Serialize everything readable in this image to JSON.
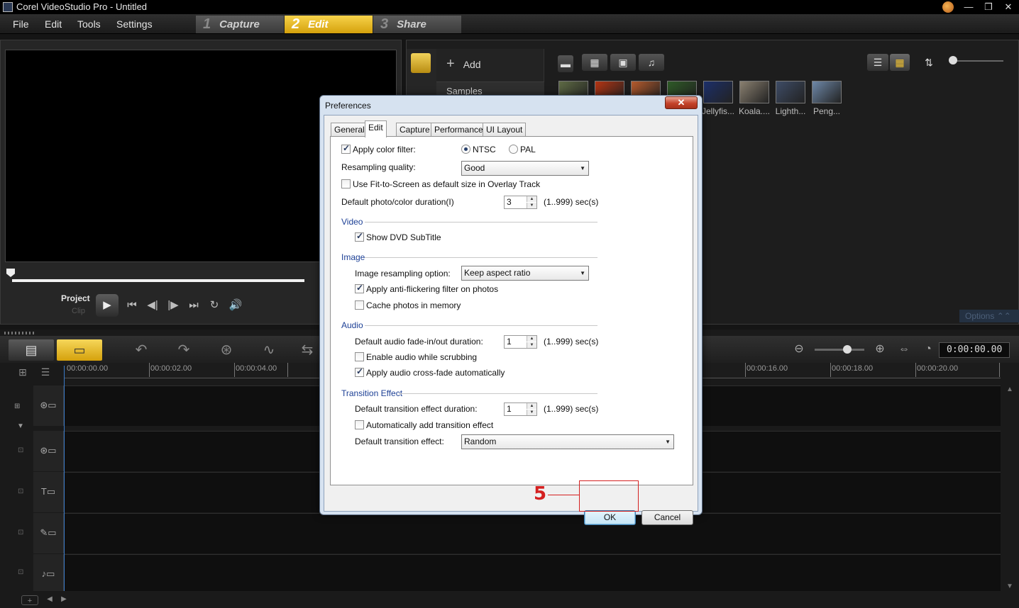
{
  "window": {
    "title": "Corel VideoStudio Pro - Untitled"
  },
  "menu": [
    "File",
    "Edit",
    "Tools",
    "Settings"
  ],
  "steps": [
    {
      "num": "1",
      "label": "Capture",
      "active": false
    },
    {
      "num": "2",
      "label": "Edit",
      "active": true
    },
    {
      "num": "3",
      "label": "Share",
      "active": false
    }
  ],
  "player": {
    "project_label": "Project",
    "clip_label": "Clip"
  },
  "library": {
    "add_label": "Add",
    "samples_label": "Samples",
    "thumbnails": [
      {
        "label": "",
        "color": "#5e6a44"
      },
      {
        "label": "",
        "color": "#b53412"
      },
      {
        "label": "",
        "color": "#b55a2c"
      },
      {
        "label": "",
        "color": "#2e5a26"
      },
      {
        "label": "Jellyfis...",
        "color": "#1c2f6a"
      },
      {
        "label": "Koala....",
        "color": "#8a8070"
      },
      {
        "label": "Lighth...",
        "color": "#3e4c66"
      },
      {
        "label": "Peng...",
        "color": "#6e88a8"
      }
    ],
    "options_label": "Options"
  },
  "timeline": {
    "timecode": "0:00:00.00",
    "ticks": [
      "00:00:00.00",
      "00:00:02.00",
      "00:00:04.00",
      "00:00:16.00",
      "00:00:18.00",
      "00:00:20.00"
    ]
  },
  "dialog": {
    "title": "Preferences",
    "close_label": "✕",
    "tabs": [
      "General",
      "Edit",
      "Capture",
      "Performance",
      "UI Layout"
    ],
    "active_tab": "Edit",
    "apply_color_filter": {
      "label": "Apply color filter:",
      "checked": true
    },
    "ntsc_label": "NTSC",
    "pal_label": "PAL",
    "resampling_label": "Resampling quality:",
    "resampling_value": "Good",
    "fit_to_screen": {
      "label": "Use Fit-to-Screen as default size in Overlay Track",
      "checked": false
    },
    "photo_duration_label": "Default photo/color duration(I)",
    "photo_duration_value": "3",
    "range_label": "(1..999) sec(s)",
    "video_section": "Video",
    "show_dvd_subtitle": {
      "label": "Show DVD SubTitle",
      "checked": true
    },
    "image_section": "Image",
    "image_resampling_label": "Image resampling option:",
    "image_resampling_value": "Keep aspect ratio",
    "anti_flicker": {
      "label": "Apply anti-flickering filter on photos",
      "checked": true
    },
    "cache_photos": {
      "label": "Cache photos in memory",
      "checked": false
    },
    "audio_section": "Audio",
    "audio_fade_label": "Default audio fade-in/out duration:",
    "audio_fade_value": "1",
    "enable_audio_scrub": {
      "label": "Enable audio while scrubbing",
      "checked": false
    },
    "audio_crossfade": {
      "label": "Apply audio cross-fade automatically",
      "checked": true
    },
    "transition_section": "Transition Effect",
    "transition_duration_label": "Default transition effect duration:",
    "transition_duration_value": "1",
    "auto_transition": {
      "label": "Automatically add transition effect",
      "checked": false
    },
    "default_transition_label": "Default transition effect:",
    "default_transition_value": "Random",
    "ok_label": "OK",
    "cancel_label": "Cancel"
  },
  "annotation": {
    "step_number": "5",
    "color": "#d42020"
  }
}
